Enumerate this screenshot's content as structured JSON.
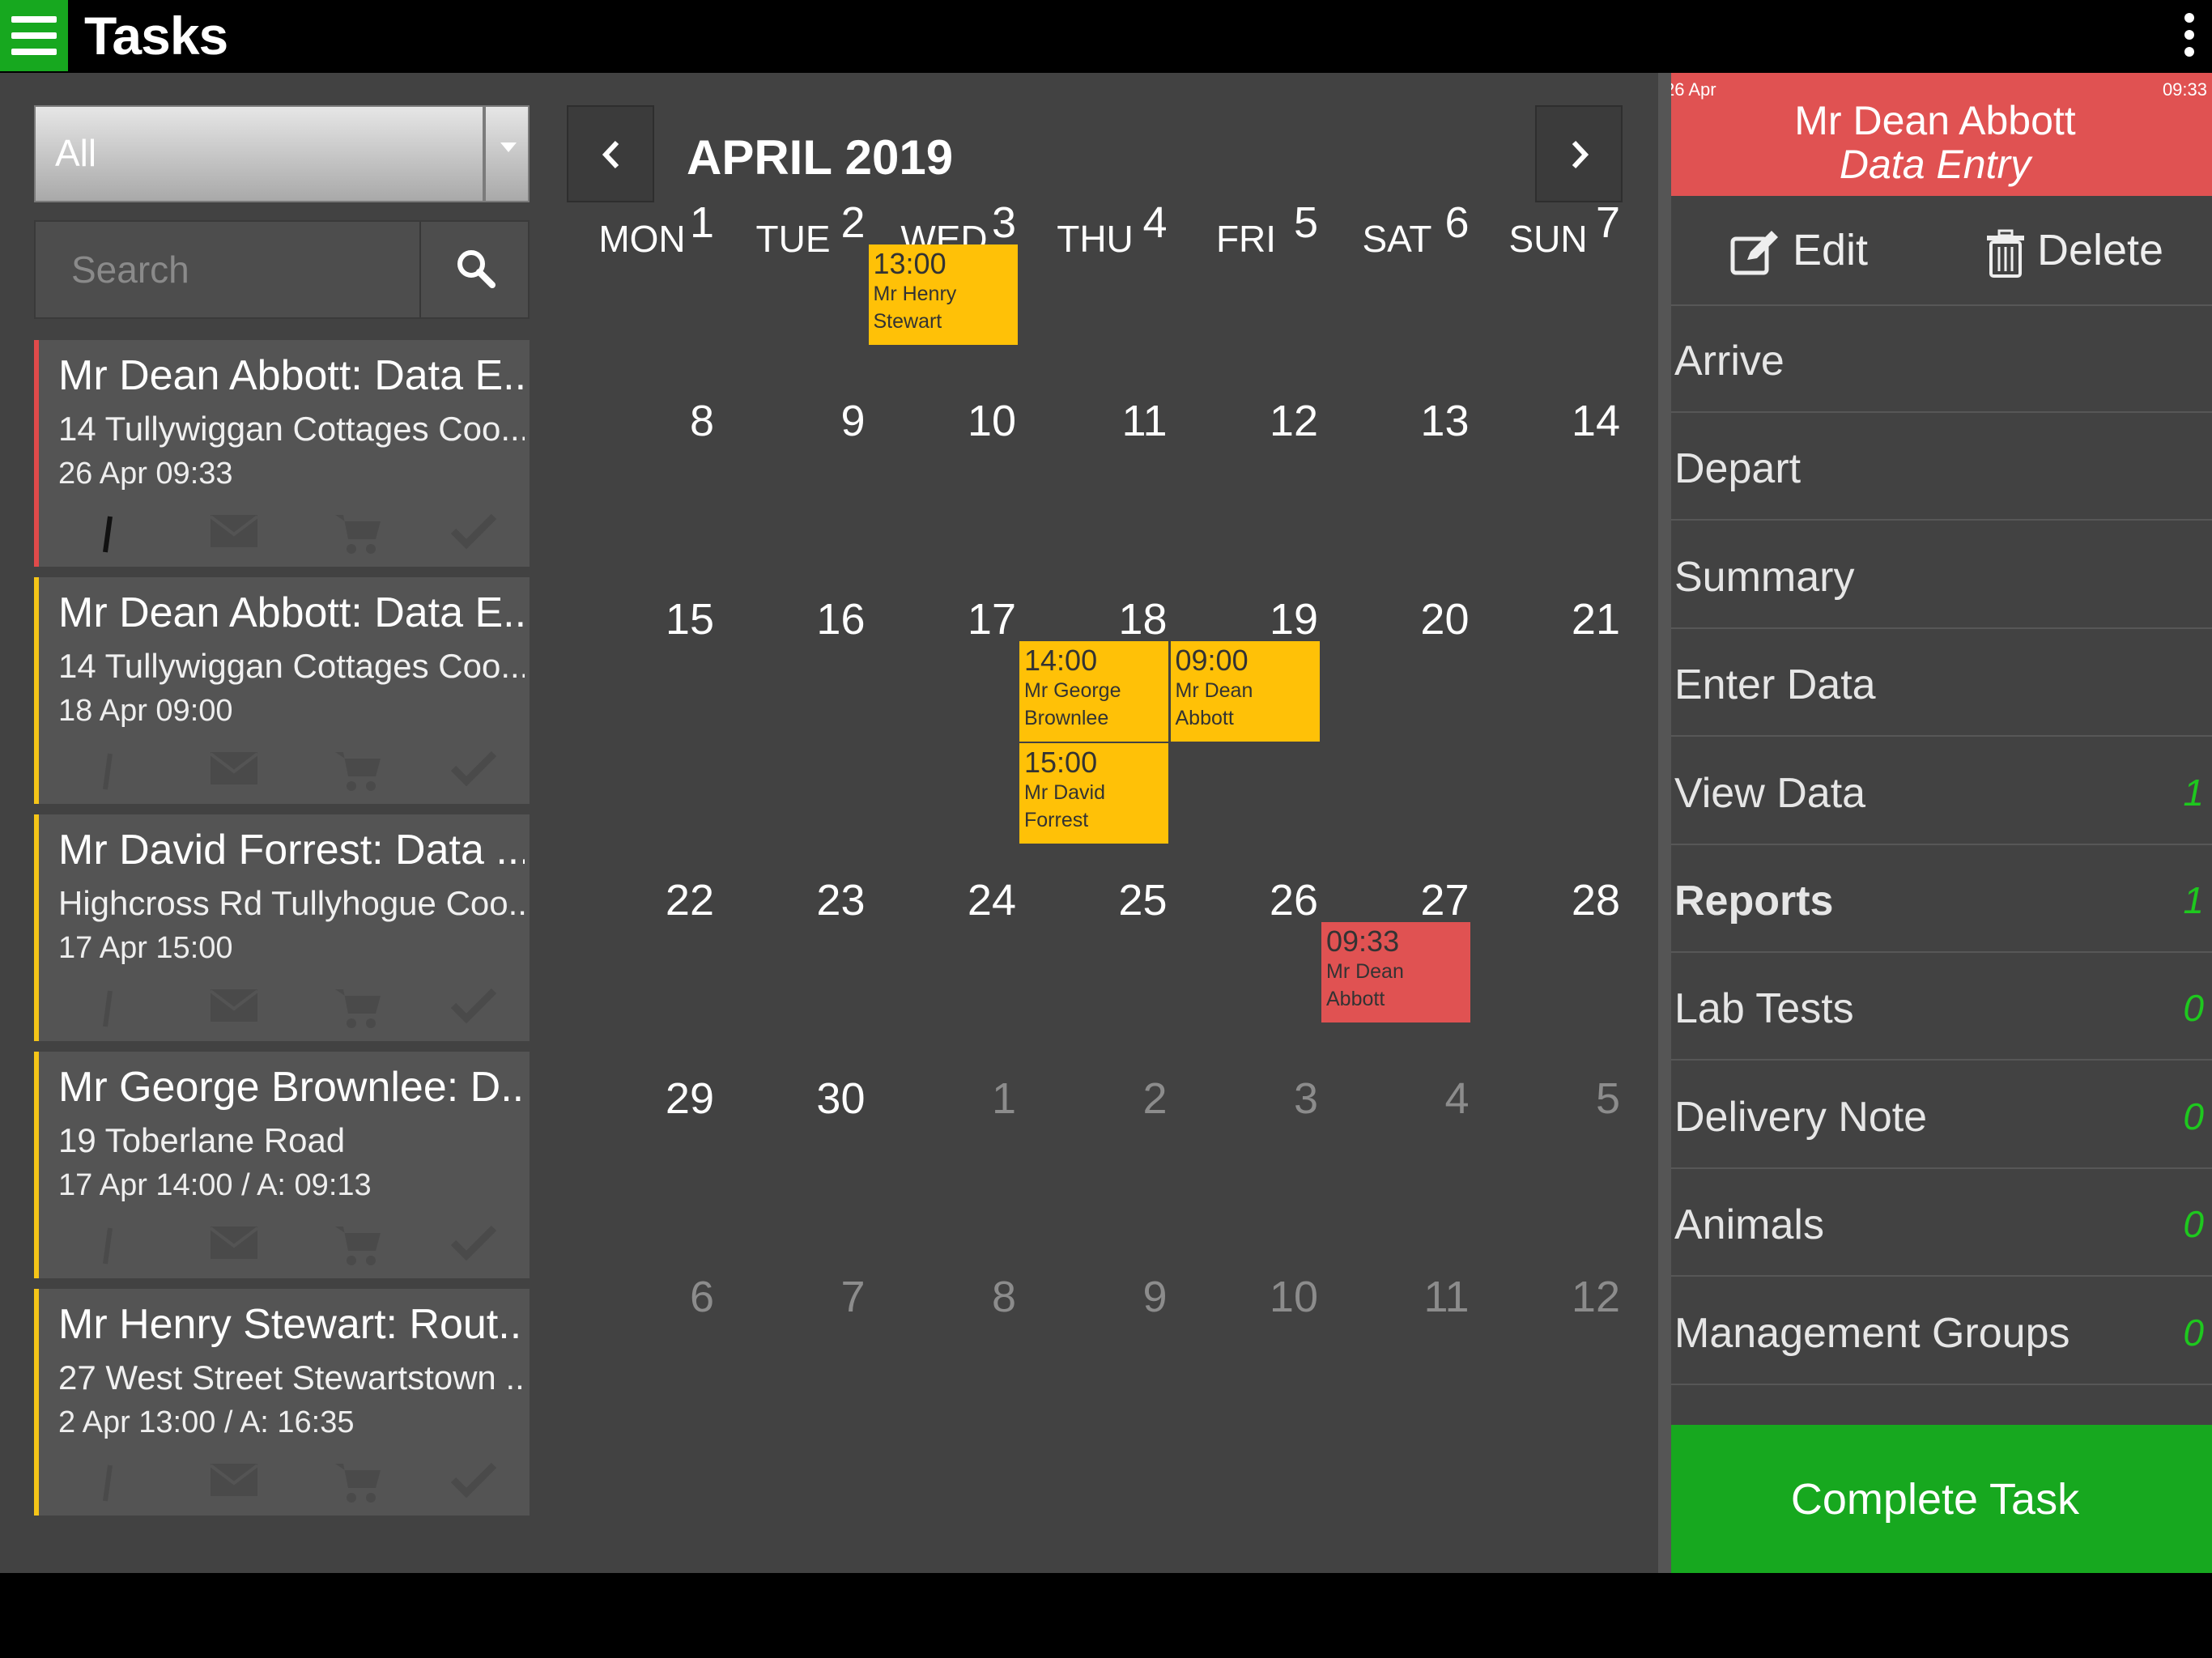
{
  "app": {
    "title": "Tasks"
  },
  "filter": {
    "selected": "All"
  },
  "search": {
    "placeholder": "Search"
  },
  "tasks": [
    {
      "title": "Mr Dean Abbott: Data E...",
      "address": "14 Tullywiggan Cottages Coo...",
      "date": "26 Apr 09:33",
      "status": "red"
    },
    {
      "title": "Mr Dean Abbott: Data E...",
      "address": "14 Tullywiggan Cottages Coo...",
      "date": "18 Apr 09:00",
      "status": "yellow"
    },
    {
      "title": "Mr David Forrest: Data ...",
      "address": "Highcross Rd Tullyhogue Coo...",
      "date": "17 Apr 15:00",
      "status": "yellow"
    },
    {
      "title": "Mr George Brownlee: D...",
      "address": "19 Toberlane Road",
      "date": "17 Apr 14:00 / A: 09:13",
      "status": "yellow"
    },
    {
      "title": "Mr Henry Stewart: Rout...",
      "address": "27 West Street Stewartstown ...",
      "date": "2 Apr 13:00 / A: 16:35",
      "status": "yellow"
    }
  ],
  "task_icons": [
    "note-icon",
    "mail-icon",
    "cart-icon",
    "checkmark-icon"
  ],
  "calendar": {
    "month_label": "APRIL 2019",
    "weekdays": [
      "MON",
      "TUE",
      "WED",
      "THU",
      "FRI",
      "SAT",
      "SUN"
    ],
    "weeks": [
      [
        "1",
        "2",
        "3",
        "4",
        "5",
        "6",
        "7"
      ],
      [
        "8",
        "9",
        "10",
        "11",
        "12",
        "13",
        "14"
      ],
      [
        "15",
        "16",
        "17",
        "18",
        "19",
        "20",
        "21"
      ],
      [
        "22",
        "23",
        "24",
        "25",
        "26",
        "27",
        "28"
      ],
      [
        "29",
        "30",
        "1",
        "2",
        "3",
        "4",
        "5"
      ],
      [
        "6",
        "7",
        "8",
        "9",
        "10",
        "11",
        "12"
      ]
    ],
    "events": [
      {
        "time": "13:00",
        "name": "Mr Henry Stewart",
        "day": "2",
        "color": "yellow"
      },
      {
        "time": "14:00",
        "name": "Mr George Brownlee",
        "day": "17",
        "color": "yellow"
      },
      {
        "time": "09:00",
        "name": "Mr Dean Abbott",
        "day": "18",
        "color": "yellow"
      },
      {
        "time": "15:00",
        "name": "Mr David Forrest",
        "day": "17",
        "color": "yellow"
      },
      {
        "time": "09:33",
        "name": "Mr Dean Abbott",
        "day": "26",
        "color": "red"
      }
    ]
  },
  "detail": {
    "date": "26 Apr",
    "time": "09:33",
    "name": "Mr Dean Abbott",
    "type": "Data Entry",
    "edit_label": "Edit",
    "delete_label": "Delete",
    "menu": [
      {
        "label": "Arrive",
        "count": "",
        "bold": false
      },
      {
        "label": "Depart",
        "count": "",
        "bold": false
      },
      {
        "label": "Summary",
        "count": "",
        "bold": false
      },
      {
        "label": "Enter Data",
        "count": "",
        "bold": false
      },
      {
        "label": "View Data",
        "count": "1",
        "bold": false
      },
      {
        "label": "Reports",
        "count": "1",
        "bold": true
      },
      {
        "label": "Lab Tests",
        "count": "0",
        "bold": false
      },
      {
        "label": "Delivery Note",
        "count": "0",
        "bold": false
      },
      {
        "label": "Animals",
        "count": "0",
        "bold": false
      },
      {
        "label": "Management Groups",
        "count": "0",
        "bold": false
      }
    ],
    "complete_label": "Complete Task"
  },
  "colors": {
    "accent_green": "#17a81f",
    "event_yellow": "#ffc107",
    "event_red": "#e05252",
    "count_green": "#1ec81e"
  }
}
